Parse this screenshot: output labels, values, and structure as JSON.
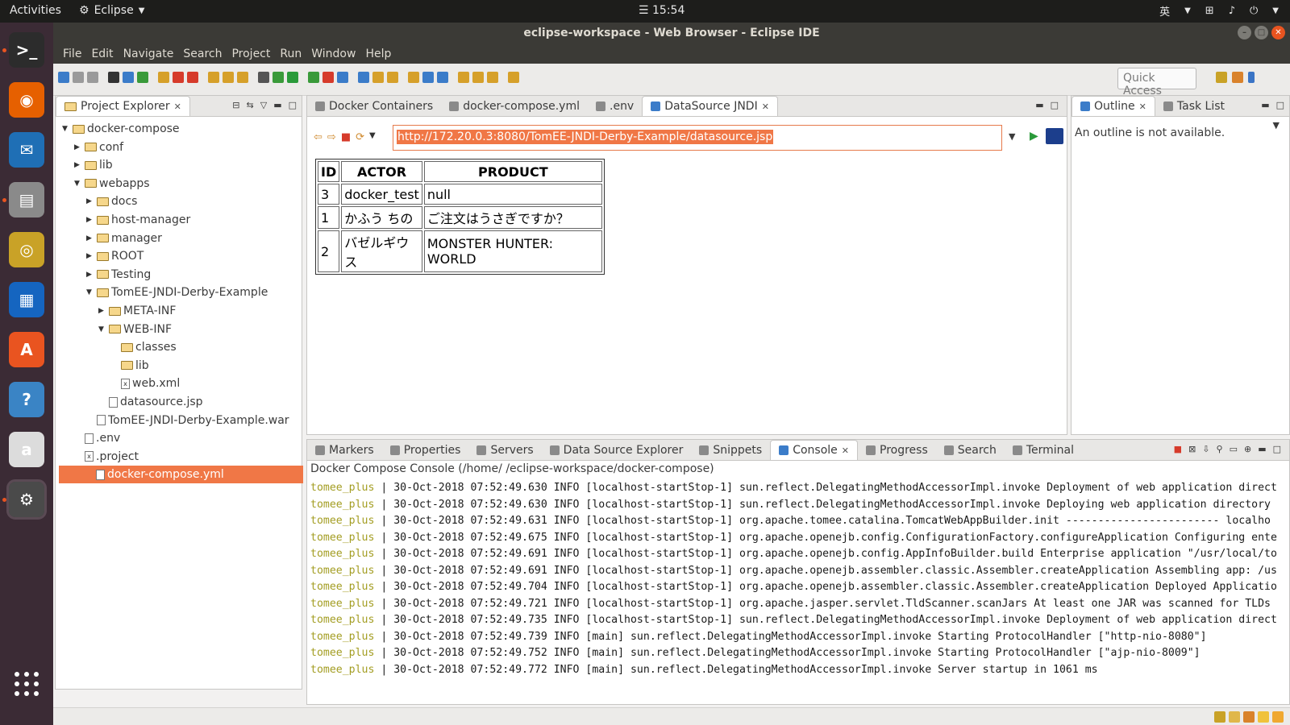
{
  "topbar": {
    "activities": "Activities",
    "app_name": "Eclipse",
    "clock": "☰ 15:54",
    "lang": "英"
  },
  "window": {
    "title": "eclipse-workspace - Web Browser - Eclipse IDE"
  },
  "menu": [
    "File",
    "Edit",
    "Navigate",
    "Search",
    "Project",
    "Run",
    "Window",
    "Help"
  ],
  "toolbar": {
    "quick_access": "Quick Access"
  },
  "project_explorer": {
    "tab_label": "Project Explorer",
    "tree": [
      {
        "label": "docker-compose",
        "type": "folder",
        "depth": 0,
        "expanded": true
      },
      {
        "label": "conf",
        "type": "folder",
        "depth": 1,
        "expanded": false
      },
      {
        "label": "lib",
        "type": "folder",
        "depth": 1,
        "expanded": false
      },
      {
        "label": "webapps",
        "type": "folder",
        "depth": 1,
        "expanded": true
      },
      {
        "label": "docs",
        "type": "folder",
        "depth": 2,
        "expanded": false
      },
      {
        "label": "host-manager",
        "type": "folder",
        "depth": 2,
        "expanded": false
      },
      {
        "label": "manager",
        "type": "folder",
        "depth": 2,
        "expanded": false
      },
      {
        "label": "ROOT",
        "type": "folder",
        "depth": 2,
        "expanded": false
      },
      {
        "label": "Testing",
        "type": "folder",
        "depth": 2,
        "expanded": false
      },
      {
        "label": "TomEE-JNDI-Derby-Example",
        "type": "folder",
        "depth": 2,
        "expanded": true
      },
      {
        "label": "META-INF",
        "type": "folder",
        "depth": 3,
        "expanded": false
      },
      {
        "label": "WEB-INF",
        "type": "folder",
        "depth": 3,
        "expanded": true
      },
      {
        "label": "classes",
        "type": "folder",
        "depth": 4,
        "expanded": null
      },
      {
        "label": "lib",
        "type": "folder",
        "depth": 4,
        "expanded": null
      },
      {
        "label": "web.xml",
        "type": "xml",
        "depth": 4,
        "expanded": null
      },
      {
        "label": "datasource.jsp",
        "type": "file",
        "depth": 3,
        "expanded": null
      },
      {
        "label": "TomEE-JNDI-Derby-Example.war",
        "type": "file",
        "depth": 2,
        "expanded": null
      },
      {
        "label": ".env",
        "type": "file",
        "depth": 1,
        "expanded": null
      },
      {
        "label": ".project",
        "type": "xml",
        "depth": 1,
        "expanded": null
      },
      {
        "label": "docker-compose.yml",
        "type": "file",
        "depth": 1,
        "expanded": null,
        "selected": true
      }
    ]
  },
  "editor": {
    "tabs": [
      {
        "label": "Docker Containers",
        "active": false
      },
      {
        "label": "docker-compose.yml",
        "active": false
      },
      {
        "label": ".env",
        "active": false
      },
      {
        "label": "DataSource JNDI",
        "active": true
      }
    ],
    "url": "http://172.20.0.3:8080/TomEE-JNDI-Derby-Example/datasource.jsp",
    "table": {
      "headers": [
        "ID",
        "ACTOR",
        "PRODUCT"
      ],
      "rows": [
        [
          "3",
          "docker_test",
          "null"
        ],
        [
          "1",
          "かふう ちの",
          "ご注文はうさぎですか？"
        ],
        [
          "2",
          "バゼルギウス",
          "MONSTER HUNTER: WORLD"
        ]
      ]
    }
  },
  "outline": {
    "tabs": [
      {
        "label": "Outline",
        "active": true
      },
      {
        "label": "Task List",
        "active": false
      }
    ],
    "message": "An outline is not available."
  },
  "bottom": {
    "tabs": [
      {
        "label": "Markers",
        "active": false
      },
      {
        "label": "Properties",
        "active": false
      },
      {
        "label": "Servers",
        "active": false
      },
      {
        "label": "Data Source Explorer",
        "active": false
      },
      {
        "label": "Snippets",
        "active": false
      },
      {
        "label": "Console",
        "active": true
      },
      {
        "label": "Progress",
        "active": false
      },
      {
        "label": "Search",
        "active": false
      },
      {
        "label": "Terminal",
        "active": false
      }
    ],
    "console_title": "Docker Compose Console (/home/        /eclipse-workspace/docker-compose)",
    "lines": [
      {
        "svc": "tomee_plus",
        "text": "30-Oct-2018 07:52:49.630 INFO [localhost-startStop-1] sun.reflect.DelegatingMethodAccessorImpl.invoke Deployment of web application direct"
      },
      {
        "svc": "tomee_plus",
        "text": "30-Oct-2018 07:52:49.630 INFO [localhost-startStop-1] sun.reflect.DelegatingMethodAccessorImpl.invoke Deploying web application directory"
      },
      {
        "svc": "tomee_plus",
        "text": "30-Oct-2018 07:52:49.631 INFO [localhost-startStop-1] org.apache.tomee.catalina.TomcatWebAppBuilder.init ------------------------ localho"
      },
      {
        "svc": "tomee_plus",
        "text": "30-Oct-2018 07:52:49.675 INFO [localhost-startStop-1] org.apache.openejb.config.ConfigurationFactory.configureApplication Configuring ente"
      },
      {
        "svc": "tomee_plus",
        "text": "30-Oct-2018 07:52:49.691 INFO [localhost-startStop-1] org.apache.openejb.config.AppInfoBuilder.build Enterprise application \"/usr/local/to"
      },
      {
        "svc": "tomee_plus",
        "text": "30-Oct-2018 07:52:49.691 INFO [localhost-startStop-1] org.apache.openejb.assembler.classic.Assembler.createApplication Assembling app: /us"
      },
      {
        "svc": "tomee_plus",
        "text": "30-Oct-2018 07:52:49.704 INFO [localhost-startStop-1] org.apache.openejb.assembler.classic.Assembler.createApplication Deployed Applicatio"
      },
      {
        "svc": "tomee_plus",
        "text": "30-Oct-2018 07:52:49.721 INFO [localhost-startStop-1] org.apache.jasper.servlet.TldScanner.scanJars At least one JAR was scanned for TLDs"
      },
      {
        "svc": "tomee_plus",
        "text": "30-Oct-2018 07:52:49.735 INFO [localhost-startStop-1] sun.reflect.DelegatingMethodAccessorImpl.invoke Deployment of web application direct"
      },
      {
        "svc": "tomee_plus",
        "text": "30-Oct-2018 07:52:49.739 INFO [main] sun.reflect.DelegatingMethodAccessorImpl.invoke Starting ProtocolHandler [\"http-nio-8080\"]"
      },
      {
        "svc": "tomee_plus",
        "text": "30-Oct-2018 07:52:49.752 INFO [main] sun.reflect.DelegatingMethodAccessorImpl.invoke Starting ProtocolHandler [\"ajp-nio-8009\"]"
      },
      {
        "svc": "tomee_plus",
        "text": "30-Oct-2018 07:52:49.772 INFO [main] sun.reflect.DelegatingMethodAccessorImpl.invoke Server startup in 1061 ms"
      }
    ]
  },
  "dock": [
    {
      "name": "terminal-icon",
      "color": "#2c2c2c",
      "glyph": ">_"
    },
    {
      "name": "firefox-icon",
      "color": "#e66000",
      "glyph": "◉"
    },
    {
      "name": "thunderbird-icon",
      "color": "#1f6fb5",
      "glyph": "✉"
    },
    {
      "name": "files-icon",
      "color": "#8a8a8a",
      "glyph": "▤"
    },
    {
      "name": "rhythmbox-icon",
      "color": "#c9a227",
      "glyph": "◎"
    },
    {
      "name": "writer-icon",
      "color": "#1565c0",
      "glyph": "▦"
    },
    {
      "name": "software-icon",
      "color": "#e95420",
      "glyph": "A"
    },
    {
      "name": "help-icon",
      "color": "#3a84c5",
      "glyph": "?"
    },
    {
      "name": "amazon-icon",
      "color": "#dcdcdc",
      "glyph": "a"
    },
    {
      "name": "eclipse-javaee-icon",
      "color": "#4a4a4a",
      "glyph": "⚙"
    }
  ],
  "colors": {
    "accent": "#f07746",
    "console_service": "#a39d22"
  }
}
